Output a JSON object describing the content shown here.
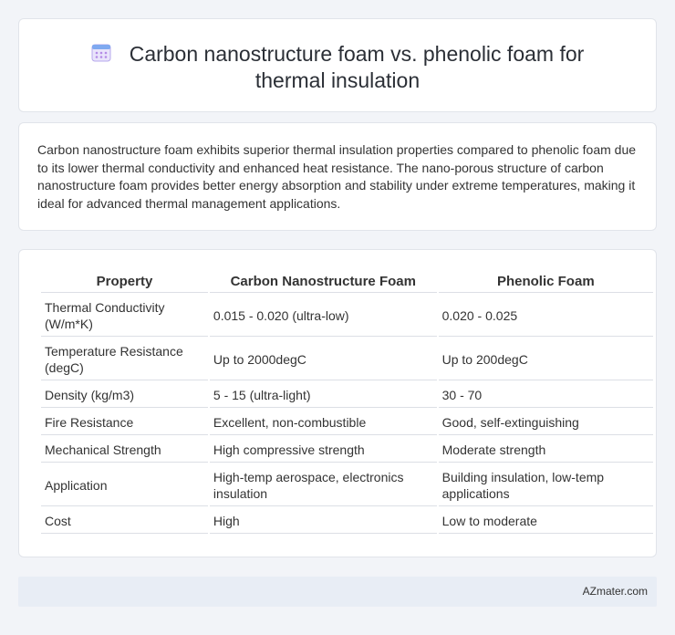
{
  "header": {
    "icon": "calendar-icon",
    "title": "Carbon nanostructure foam vs. phenolic foam for thermal insulation"
  },
  "summary": {
    "text": "Carbon nanostructure foam exhibits superior thermal insulation properties compared to phenolic foam due to its lower thermal conductivity and enhanced heat resistance. The nano-porous structure of carbon nanostructure foam provides better energy absorption and stability under extreme temperatures, making it ideal for advanced thermal management applications."
  },
  "table": {
    "headers": [
      "Property",
      "Carbon Nanostructure Foam",
      "Phenolic Foam"
    ],
    "rows": [
      [
        "Thermal Conductivity (W/m*K)",
        "0.015 - 0.020 (ultra-low)",
        "0.020 - 0.025"
      ],
      [
        "Temperature Resistance (degC)",
        "Up to 2000degC",
        "Up to 200degC"
      ],
      [
        "Density (kg/m3)",
        "5 - 15 (ultra-light)",
        "30 - 70"
      ],
      [
        "Fire Resistance",
        "Excellent, non-combustible",
        "Good, self-extinguishing"
      ],
      [
        "Mechanical Strength",
        "High compressive strength",
        "Moderate strength"
      ],
      [
        "Application",
        "High-temp aerospace, electronics insulation",
        "Building insulation, low-temp applications"
      ],
      [
        "Cost",
        "High",
        "Low to moderate"
      ]
    ]
  },
  "footer": {
    "text": "AZmater.com"
  }
}
